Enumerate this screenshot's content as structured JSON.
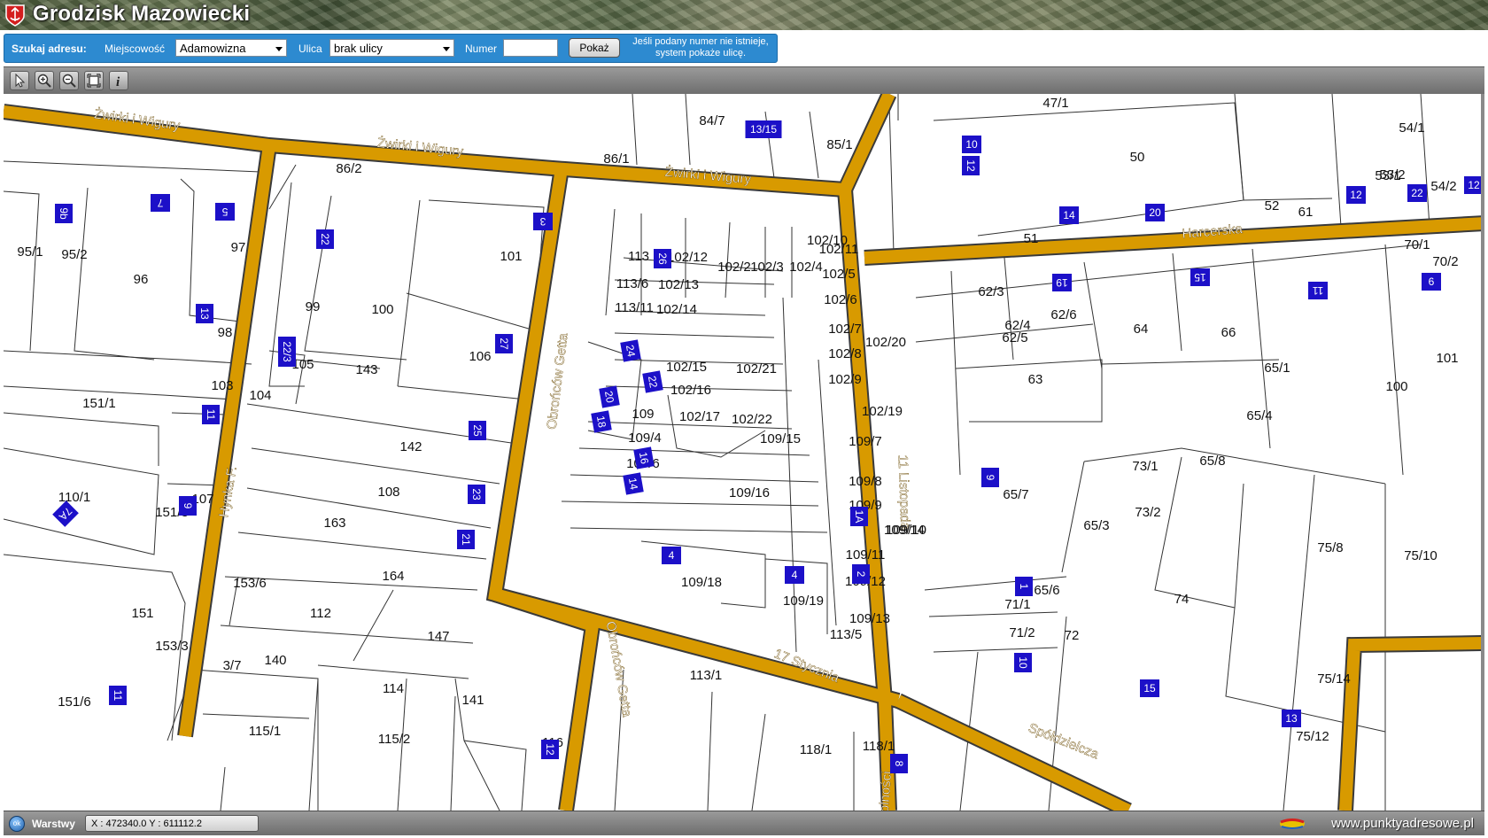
{
  "header": {
    "title": "Grodzisk Mazowiecki",
    "logo_icon": "city-crest-icon"
  },
  "search": {
    "label": "Szukaj adresu:",
    "locality_label": "Miejscowość",
    "locality_value": "Adamowizna",
    "street_label": "Ulica",
    "street_value": "brak ulicy",
    "number_label": "Numer",
    "number_value": "",
    "show_button": "Pokaż",
    "hint": "Jeśli podany numer nie istnieje, system pokaże ulicę."
  },
  "toolbar": {
    "tools": [
      {
        "name": "select-tool",
        "icon": "arrow-pointer-icon"
      },
      {
        "name": "zoom-in-tool",
        "icon": "zoom-in-icon"
      },
      {
        "name": "zoom-out-tool",
        "icon": "zoom-out-icon"
      },
      {
        "name": "full-extent-tool",
        "icon": "extent-icon"
      },
      {
        "name": "info-tool",
        "icon": "info-icon"
      }
    ]
  },
  "map": {
    "colors": {
      "road": "#d89a00",
      "road_edge": "#3a3a3a",
      "house_number_bg": "#1c10c8",
      "parcel_line": "#333333"
    },
    "streets": [
      {
        "id": "zwirki-1",
        "name": "Żwirki i Wigury"
      },
      {
        "id": "zwirki-2",
        "name": "Żwirki i Wigury"
      },
      {
        "id": "zwirki-3",
        "name": "Żwirki i Wigury"
      },
      {
        "id": "hynka",
        "name": "Hynka F."
      },
      {
        "id": "obroncow-1",
        "name": "Obrońców Getta"
      },
      {
        "id": "obroncow-2",
        "name": "Obrońców Getta"
      },
      {
        "id": "listopada",
        "name": "11 Listopada"
      },
      {
        "id": "harcerska",
        "name": "Harcerska"
      },
      {
        "id": "stycznia",
        "name": "17 Stycznia"
      },
      {
        "id": "spoldzielcza",
        "name": "Spółdzielcza"
      },
      {
        "id": "wolnosci",
        "name": "Wolności"
      }
    ],
    "parcels": [
      "47/1",
      "84/7",
      "85/1",
      "50",
      "54/1",
      "53/1",
      "53/2",
      "54/2",
      "86/2",
      "86/1",
      "52",
      "61",
      "51",
      "95/1",
      "95/2",
      "97",
      "96",
      "101",
      "99",
      "100",
      "113",
      "102/12",
      "102/2",
      "102/3",
      "102/4",
      "102/10",
      "102/11",
      "102/5",
      "113/6",
      "102/13",
      "113/11",
      "102/14",
      "102/6",
      "62/3",
      "62/6",
      "64",
      "66",
      "70/1",
      "70/2",
      "98",
      "105",
      "143",
      "106",
      "102/15",
      "102/21",
      "102/7",
      "102/20",
      "62/4",
      "62/5",
      "103",
      "104",
      "151/1",
      "102/16",
      "102/8",
      "63",
      "65/1",
      "101",
      "100",
      "109",
      "102/17",
      "102/22",
      "102/9",
      "102/19",
      "65/4",
      "109/4",
      "109/15",
      "109/7",
      "142",
      "73/1",
      "65/8",
      "108",
      "109/6",
      "109/16",
      "109/8",
      "110/1",
      "107",
      "151/3",
      "65/7",
      "163",
      "109/9",
      "73/2",
      "65/3",
      "109/10",
      "109/14",
      "75/8",
      "75/10",
      "164",
      "109/18",
      "109/11",
      "109/12",
      "153/6",
      "112",
      "109/19",
      "65/6",
      "74",
      "151",
      "147",
      "109/13",
      "71/1",
      "153/3",
      "113/5",
      "71/2",
      "72",
      "140",
      "3/7",
      "113/1",
      "114",
      "141",
      "75/14",
      "151/6",
      "115/1",
      "115/2",
      "116",
      "75/12",
      "118/1",
      "118/1"
    ],
    "house_numbers": [
      "13/15",
      "12",
      "9b",
      "7",
      "5",
      "3",
      "22",
      "26",
      "19",
      "15",
      "11",
      "6",
      "13",
      "27",
      "22/3",
      "24",
      "22",
      "20",
      "18",
      "9",
      "25",
      "11",
      "7A",
      "16",
      "14",
      "23",
      "1A",
      "4",
      "9",
      "21",
      "4",
      "2",
      "1",
      "10",
      "11",
      "15",
      "12",
      "8",
      "13",
      "10",
      "12",
      "14",
      "20",
      "22",
      "12",
      "10"
    ]
  },
  "status": {
    "layers_icon": "layers-icon",
    "layers_label": "Warstwy",
    "coordinates": "X : 472340.0  Y : 611112.2",
    "brand": "www.punktyadresowe.pl",
    "brand_icon": "globe-flag-icon"
  }
}
